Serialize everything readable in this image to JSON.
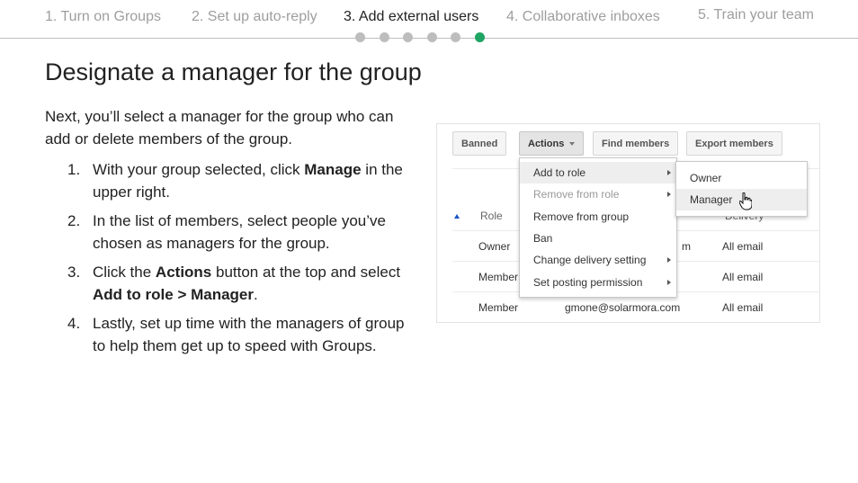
{
  "nav": {
    "steps": [
      "1. Turn on Groups",
      "2. Set up auto-reply",
      "3. Add external users",
      "4. Collaborative inboxes",
      "5. Train your team"
    ],
    "active_step": 3,
    "progress_dots_total": 6,
    "progress_current_dot": 6,
    "accent_color": "#1fa463"
  },
  "content": {
    "heading": "Designate a manager for the group",
    "intro": "Next, you’ll select a manager for the group who can add or delete members of the group.",
    "steps": [
      {
        "num": "1.",
        "parts": [
          {
            "t": "With your group selected, click "
          },
          {
            "t": "Manage",
            "b": true
          },
          {
            "t": " in the upper right."
          }
        ]
      },
      {
        "num": "2.",
        "parts": [
          {
            "t": "In the list of members, select people you’ve chosen as managers for the group."
          }
        ]
      },
      {
        "num": "3.",
        "parts": [
          {
            "t": "Click the "
          },
          {
            "t": "Actions",
            "b": true
          },
          {
            "t": " button at the top and select "
          },
          {
            "t": "Add to role > Manager",
            "b": true
          },
          {
            "t": "."
          }
        ]
      },
      {
        "num": "4.",
        "parts": [
          {
            "t": "Lastly, set up time with the managers of group to help them get up to speed with Groups."
          }
        ]
      }
    ]
  },
  "screenshot": {
    "toolbar": {
      "banned": "Banned",
      "actions": "Actions",
      "find_members": "Find members",
      "export_members": "Export members"
    },
    "columns": {
      "role": "Role",
      "delivery": "Delivery"
    },
    "rows": [
      {
        "role": "Owner",
        "email": "m",
        "delivery": "All email"
      },
      {
        "role": "Member",
        "email": "",
        "delivery": "All email"
      },
      {
        "role": "Member",
        "email": "gmone@solarmora.com",
        "delivery": "All email"
      }
    ],
    "menu": [
      {
        "label": "Add to role",
        "submenu": true,
        "highlighted": true,
        "disabled": false
      },
      {
        "label": "Remove from role",
        "submenu": true,
        "highlighted": false,
        "disabled": true
      },
      {
        "label": "Remove from group",
        "submenu": false,
        "highlighted": false,
        "disabled": false
      },
      {
        "label": "Ban",
        "submenu": false,
        "highlighted": false,
        "disabled": false
      },
      {
        "label": "Change delivery setting",
        "submenu": true,
        "highlighted": false,
        "disabled": false
      },
      {
        "label": "Set posting permission",
        "submenu": true,
        "highlighted": false,
        "disabled": false
      }
    ],
    "submenu": [
      {
        "label": "Owner",
        "highlighted": false
      },
      {
        "label": "Manager",
        "highlighted": true
      }
    ]
  }
}
